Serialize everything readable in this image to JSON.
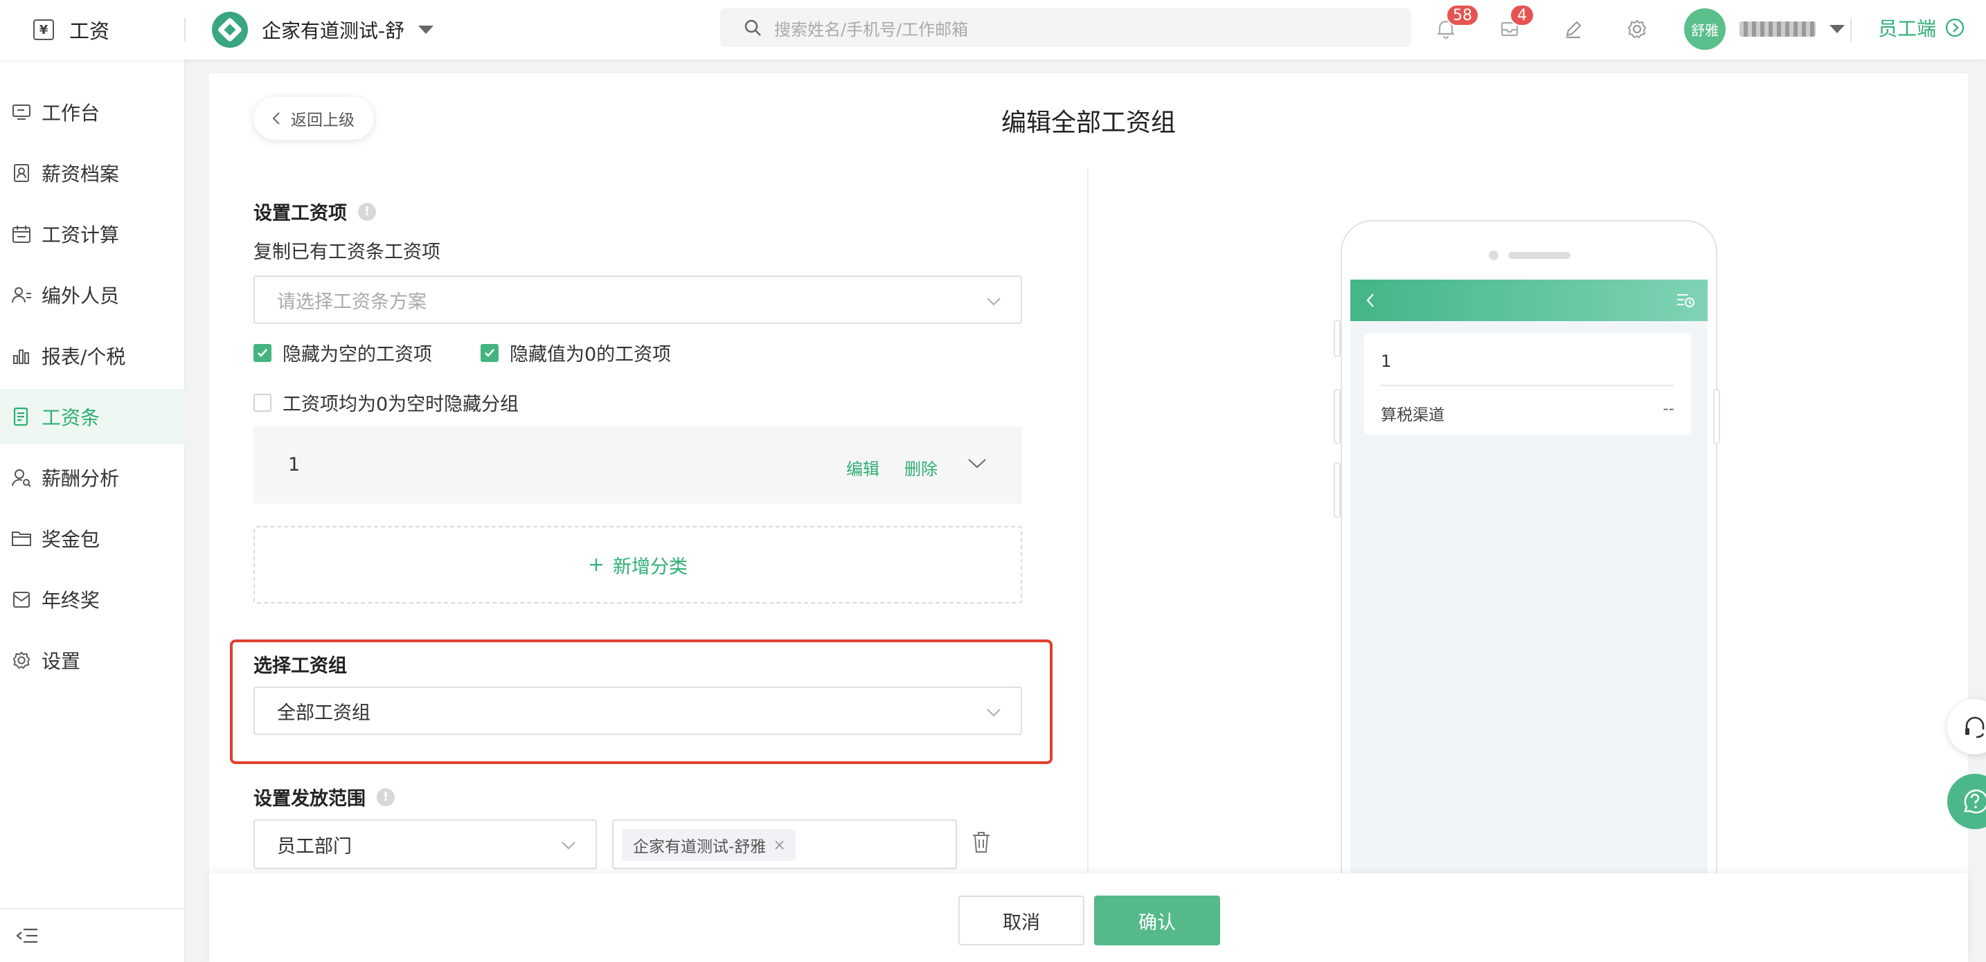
{
  "app": {
    "title": "工资"
  },
  "company": {
    "name": "企家有道测试-舒"
  },
  "search": {
    "placeholder": "搜索姓名/手机号/工作邮箱"
  },
  "notifications": {
    "bell_count": "58",
    "inbox_count": "4"
  },
  "user": {
    "avatar_text": "舒雅"
  },
  "employee_link": {
    "label": "员工端"
  },
  "sidebar": {
    "items": [
      {
        "label": "工作台",
        "icon": "monitor-icon"
      },
      {
        "label": "薪资档案",
        "icon": "profile-icon"
      },
      {
        "label": "工资计算",
        "icon": "calendar-icon"
      },
      {
        "label": "编外人员",
        "icon": "people-icon"
      },
      {
        "label": "报表/个税",
        "icon": "bar-chart-icon"
      },
      {
        "label": "工资条",
        "icon": "payslip-icon",
        "active": true
      },
      {
        "label": "薪酬分析",
        "icon": "person-search-icon"
      },
      {
        "label": "奖金包",
        "icon": "folder-icon"
      },
      {
        "label": "年终奖",
        "icon": "gift-icon"
      },
      {
        "label": "设置",
        "icon": "gear-icon"
      }
    ]
  },
  "page": {
    "back_label": "返回上级",
    "title": "编辑全部工资组"
  },
  "form": {
    "set_items_label": "设置工资项",
    "copy_label": "复制已有工资条工资项",
    "copy_placeholder": "请选择工资条方案",
    "checkbox_hide_empty": "隐藏为空的工资项",
    "checkbox_hide_zero": "隐藏值为0的工资项",
    "checkbox_hide_group": "工资项均为0为空时隐藏分组",
    "group_name": "1",
    "edit_label": "编辑",
    "delete_label": "删除",
    "add_category_label": "新增分类",
    "select_group_label": "选择工资组",
    "select_group_value": "全部工资组",
    "range_label": "设置发放范围",
    "range_type_value": "员工部门",
    "range_tag": "企家有道测试-舒雅"
  },
  "preview": {
    "group_name": "1",
    "row_label": "算税渠道",
    "row_value": "--"
  },
  "footer": {
    "cancel_label": "取消",
    "confirm_label": "确认"
  },
  "colors": {
    "accent": "#2dae74",
    "highlight_border": "#e0402f",
    "badge": "#e55451"
  }
}
